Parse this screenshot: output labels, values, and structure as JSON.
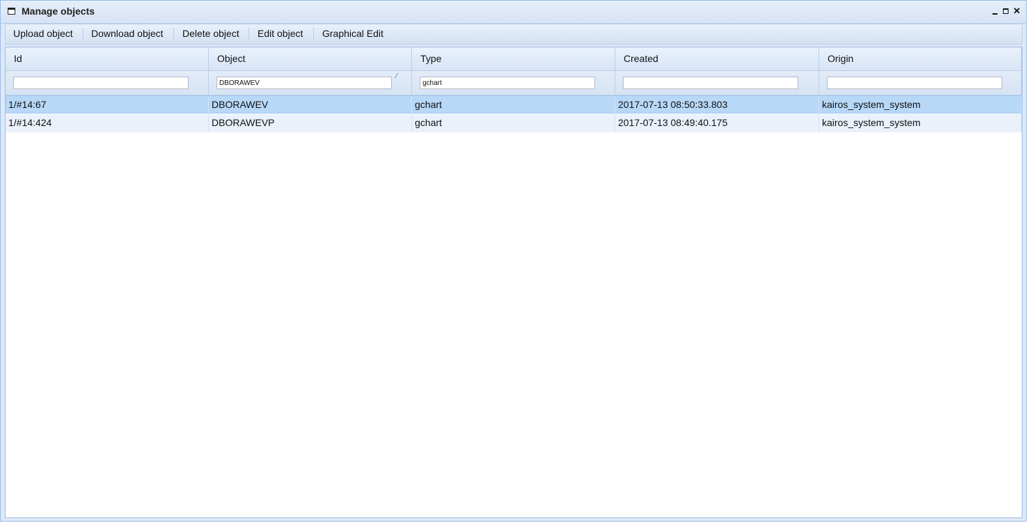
{
  "window": {
    "title": "Manage objects",
    "minimize_icon": "minimize-icon",
    "maximize_icon": "maximize-icon",
    "close_icon": "close-icon",
    "close_glyph": "✕"
  },
  "toolbar": {
    "upload": "Upload object",
    "download": "Download object",
    "delete": "Delete object",
    "edit": "Edit object",
    "graphical_edit": "Graphical Edit"
  },
  "grid": {
    "columns": [
      "Id",
      "Object",
      "Type",
      "Created",
      "Origin"
    ],
    "filters": {
      "id": "",
      "object": "DBORAWEV",
      "type": "gchart",
      "created": "",
      "origin": ""
    },
    "rows": [
      {
        "id": "1/#14:67",
        "object": "DBORAWEV",
        "type": "gchart",
        "created": "2017-07-13 08:50:33.803",
        "origin": "kairos_system_system"
      },
      {
        "id": "1/#14:424",
        "object": "DBORAWEVP",
        "type": "gchart",
        "created": "2017-07-13 08:49:40.175",
        "origin": "kairos_system_system"
      }
    ],
    "selected_row": 0
  },
  "colors": {
    "header_bg": "#dfe8f6",
    "selected_row": "#b8d8f8",
    "border": "#99bbe8"
  }
}
